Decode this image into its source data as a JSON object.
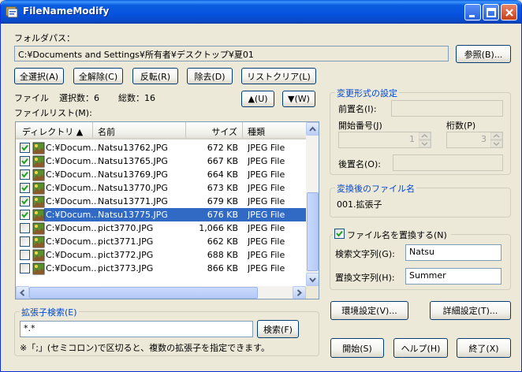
{
  "window": {
    "title": "FileNameModify"
  },
  "folder": {
    "label": "フォルダパス：",
    "path": "C:¥Documents and Settings¥所有者¥デスクトップ¥夏01",
    "browse_button": "参照(B)..."
  },
  "toolbar": {
    "select_all": "全選択(A)",
    "deselect_all": "全解除(C)",
    "invert": "反転(R)",
    "remove": "除去(D)",
    "clear_list": "リストクリア(L)",
    "move_up": "▲(U)",
    "move_down": "▼(W)"
  },
  "status": {
    "file_label": "ファイル",
    "selected_count": "選択数：6",
    "total_count": "総数：16"
  },
  "filelist": {
    "label": "ファイルリスト(M):",
    "columns": [
      "ディレクトリ ▲",
      "名前",
      "サイズ",
      "種類"
    ],
    "rows": [
      {
        "checked": true,
        "dir": "C:¥Docum...",
        "name": "Natsu13762.JPG",
        "size": "672 KB",
        "type": "JPEG File"
      },
      {
        "checked": true,
        "dir": "C:¥Docum...",
        "name": "Natsu13765.JPG",
        "size": "667 KB",
        "type": "JPEG File"
      },
      {
        "checked": true,
        "dir": "C:¥Docum...",
        "name": "Natsu13769.JPG",
        "size": "664 KB",
        "type": "JPEG File"
      },
      {
        "checked": true,
        "dir": "C:¥Docum...",
        "name": "Natsu13770.JPG",
        "size": "673 KB",
        "type": "JPEG File"
      },
      {
        "checked": true,
        "dir": "C:¥Docum...",
        "name": "Natsu13771.JPG",
        "size": "679 KB",
        "type": "JPEG File"
      },
      {
        "checked": true,
        "dir": "C:¥Docum...",
        "name": "Natsu13775.JPG",
        "size": "676 KB",
        "type": "JPEG File",
        "selected": true
      },
      {
        "checked": false,
        "dir": "C:¥Docum...",
        "name": "pict3770.JPG",
        "size": "1,066 KB",
        "type": "JPEG File"
      },
      {
        "checked": false,
        "dir": "C:¥Docum...",
        "name": "pict3771.JPG",
        "size": "662 KB",
        "type": "JPEG File"
      },
      {
        "checked": false,
        "dir": "C:¥Docum...",
        "name": "pict3772.JPG",
        "size": "688 KB",
        "type": "JPEG File"
      },
      {
        "checked": false,
        "dir": "C:¥Docum...",
        "name": "pict3773.JPG",
        "size": "866 KB",
        "type": "JPEG File"
      }
    ]
  },
  "ext_search": {
    "title": "拡張子検索(E)",
    "value": "*.*",
    "button": "検索(F)",
    "hint": "※「;」(セミコロン)で区切ると、複数の拡張子を指定できます。"
  },
  "format": {
    "title": "変更形式の設定",
    "prefix_label": "前置名(I):",
    "prefix_value": "",
    "start_label": "開始番号(J)",
    "start_value": "1",
    "digits_label": "桁数(P)",
    "digits_value": "3",
    "suffix_label": "後置名(O):",
    "suffix_value": ""
  },
  "result": {
    "title": "変換後のファイル名",
    "value": "001.拡張子"
  },
  "replace": {
    "checkbox_label": "ファイル名を置換する(N)",
    "checked": true,
    "search_label": "検索文字列(G):",
    "search_value": "Natsu",
    "replace_label": "置換文字列(H):",
    "replace_value": "Summer"
  },
  "actions": {
    "env_settings": "環境設定(V)...",
    "detail_settings": "詳細設定(T)...",
    "start": "開始(S)",
    "help": "ヘルプ(H)",
    "exit": "終了(X)"
  }
}
